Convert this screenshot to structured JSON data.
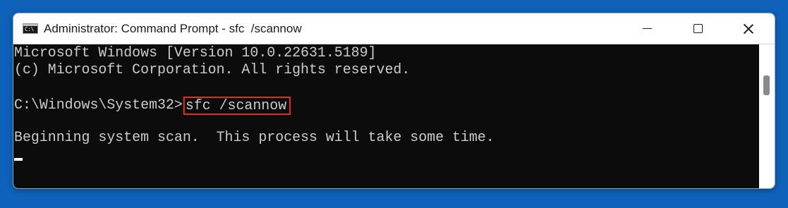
{
  "window": {
    "title": "Administrator: Command Prompt - sfc  /scannow",
    "icon": "cmd-icon"
  },
  "controls": {
    "minimize": "minimize-icon",
    "maximize": "maximize-icon",
    "close": "close-icon"
  },
  "console": {
    "line1": "Microsoft Windows [Version 10.0.22631.5189]",
    "line2": "(c) Microsoft Corporation. All rights reserved.",
    "prompt": "C:\\Windows\\System32>",
    "command": "sfc /scannow",
    "line4": "Beginning system scan.  This process will take some time."
  },
  "colors": {
    "desktop": "#0e62ba",
    "console_bg": "#0c0c0c",
    "console_text": "#cccccc",
    "highlight": "#e0311f"
  }
}
